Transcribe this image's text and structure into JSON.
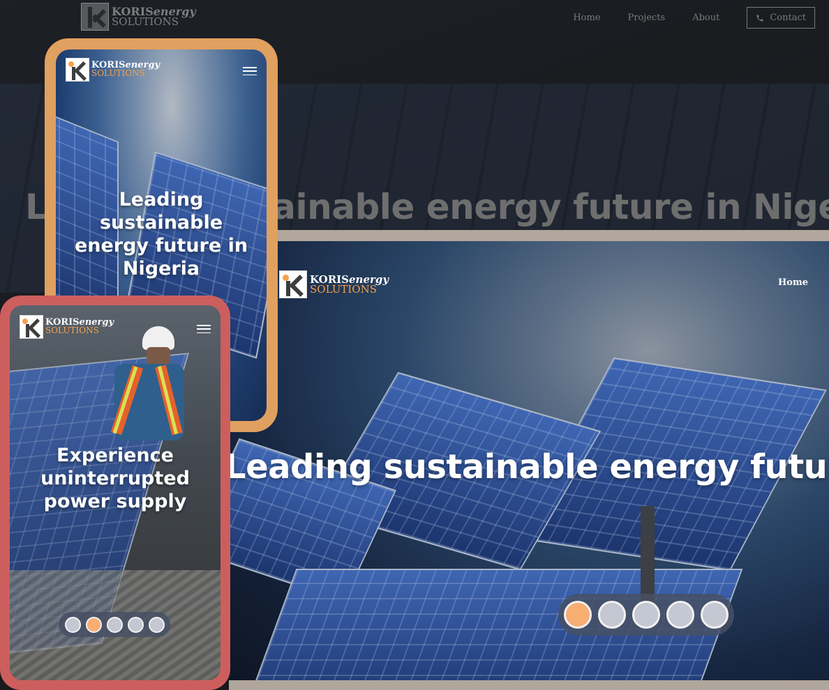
{
  "brand": {
    "name_bold": "KORIS",
    "name_italic": "energy",
    "tagline": "SOLUTIONS"
  },
  "desktop": {
    "nav": {
      "home": "Home",
      "projects": "Projects",
      "about": "About",
      "contact": "Contact"
    },
    "headline": "Leading sustainable energy future in Nigeria"
  },
  "laptop": {
    "nav_home": "Home",
    "headline": "Leading sustainable energy futu",
    "slider": {
      "count": 5,
      "active_index": 0
    }
  },
  "phone_orange": {
    "headline": "Leading sustainable energy future in Nigeria"
  },
  "phone_red": {
    "headline": "Experience uninterrupted power supply",
    "slider": {
      "count": 5,
      "active_index": 1
    }
  },
  "colors": {
    "accent_orange": "#f5a14a",
    "phone1_frame": "#e0a060",
    "phone2_frame": "#cd5e5e",
    "dot_active": "#f8ad73",
    "dot_inactive": "#c3c8d2"
  },
  "icons": [
    "hamburger-menu-icon",
    "phone-icon",
    "koris-logo-mark"
  ]
}
